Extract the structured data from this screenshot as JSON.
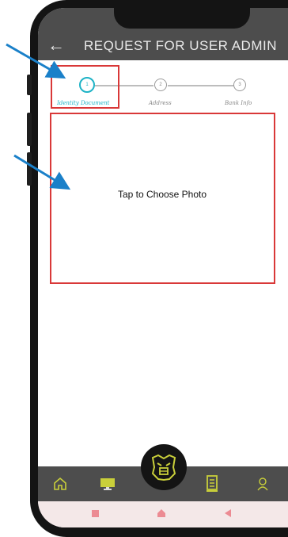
{
  "header": {
    "title": "REQUEST FOR USER ADMIN",
    "back_icon": "arrow-left-icon"
  },
  "stepper": {
    "steps": [
      {
        "number": "1",
        "label": "Identity Document",
        "active": true
      },
      {
        "number": "2",
        "label": "Address",
        "active": false
      },
      {
        "number": "3",
        "label": "Bank Info",
        "active": false
      }
    ]
  },
  "photo": {
    "label": "Tap to Choose Photo"
  },
  "bottom_nav": {
    "items": [
      "home-icon",
      "monitor-icon",
      "bulldog-logo-icon",
      "document-icon",
      "person-icon"
    ]
  },
  "colors": {
    "accent": "#1fb3c6",
    "header": "#4d4d4d",
    "highlight": "#d93838",
    "annotation_arrow": "#1a80c9",
    "nav_icon": "#c9cf3a"
  }
}
